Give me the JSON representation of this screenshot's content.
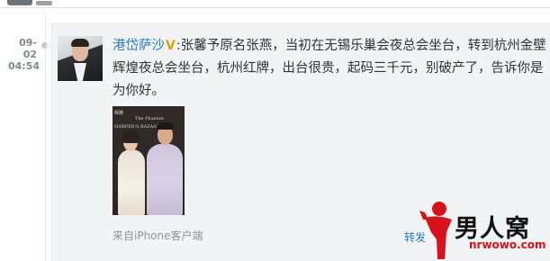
{
  "post": {
    "date_line1": "09-02",
    "date_line2": "04:54",
    "username": "港岱萨沙",
    "verified_badge": "V",
    "colon": ":",
    "content": "张馨予原名张燕，当初在无锡乐巢会夜总会坐台，转到杭州金壁辉煌夜总会坐台，杭州红牌，出台很贵，起码三千元，别破产了，告诉你是为你好。",
    "source": "来自iPhone客户端",
    "forward_label": "转发"
  },
  "photo": {
    "backdrop_text_1": "The Phaeton",
    "backdrop_text_2": "HARPER'S BAZAAR",
    "backdrop_text_3": "辉腾"
  },
  "watermark": {
    "name": "男人窝",
    "url": "nrwowo.com"
  },
  "colors": {
    "link": "#2a79c1",
    "badge": "#e0a100",
    "card_bg": "#f2f3f5",
    "watermark_red": "#d8121d"
  },
  "icons": {
    "verified": "v-badge-icon",
    "timeline": "timeline-dot-icon",
    "watermark": "person-logo-icon"
  }
}
